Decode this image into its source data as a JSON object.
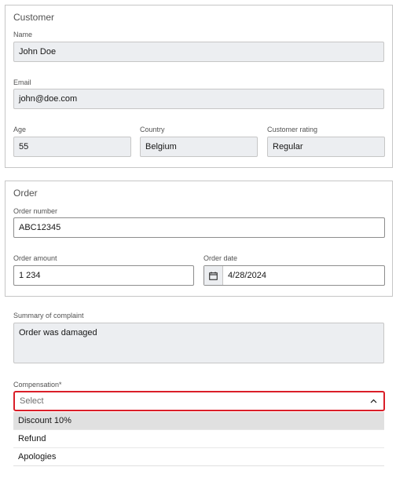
{
  "customer": {
    "title": "Customer",
    "name": {
      "label": "Name",
      "value": "John Doe"
    },
    "email": {
      "label": "Email",
      "value": "john@doe.com"
    },
    "age": {
      "label": "Age",
      "value": "55"
    },
    "country": {
      "label": "Country",
      "value": "Belgium"
    },
    "rating": {
      "label": "Customer rating",
      "value": "Regular"
    }
  },
  "order": {
    "title": "Order",
    "number": {
      "label": "Order number",
      "value": "ABC12345"
    },
    "amount": {
      "label": "Order amount",
      "value": "1 234"
    },
    "date": {
      "label": "Order date",
      "value": "4/28/2024",
      "icon": "calendar-icon"
    }
  },
  "complaint": {
    "label": "Summary of complaint",
    "value": "Order was damaged"
  },
  "compensation": {
    "label": "Compensation*",
    "placeholder": "Select",
    "icon": "chevron-up-icon",
    "options": [
      "Discount 10%",
      "Refund",
      "Apologies"
    ],
    "highlighted_index": 0
  },
  "colors": {
    "error_border": "#da1e28",
    "readonly_bg": "#eceef1",
    "highlight_bg": "#e0e0e0"
  }
}
